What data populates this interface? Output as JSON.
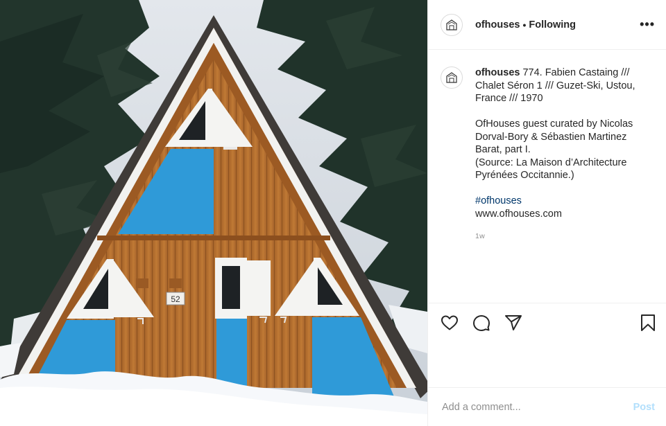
{
  "post": {
    "image_alt": "A-frame chalet with wooden facade and blue panels in snow"
  },
  "header": {
    "username": "ofhouses",
    "separator": "•",
    "follow_status": "Following",
    "more_label": "•••"
  },
  "caption": {
    "username": "ofhouses",
    "line1": "774. Fabien Castaing /// Chalet Séron 1 /// Guzet-Ski, Ustou, France /// 1970",
    "paragraph2": [
      "OfHouses guest curated by Nicolas Dorval-Bory & Sébastien Martinez Barat, part I.",
      "(Source: La Maison d’Architecture Pyrénées Occitannie.)"
    ],
    "hashtag": "#ofhouses",
    "website": "www.ofhouses.com",
    "timestamp": "1w"
  },
  "house": {
    "number": "52"
  },
  "actions": {
    "icons": [
      "heart-icon",
      "comment-icon",
      "share-icon",
      "bookmark-icon"
    ]
  },
  "comment": {
    "placeholder": "Add a comment...",
    "post_label": "Post"
  },
  "colors": {
    "wood": "#b5712e",
    "panel_blue": "#2f9ad8",
    "link": "#00376b",
    "post_disabled": "#b2dffc"
  }
}
